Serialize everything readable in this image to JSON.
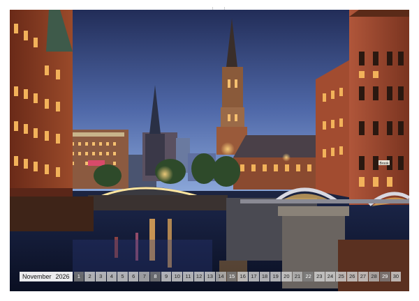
{
  "calendar": {
    "month": "November",
    "year": "2026",
    "days": [
      {
        "num": "1",
        "type": "sunday"
      },
      {
        "num": "2",
        "type": "weekday"
      },
      {
        "num": "3",
        "type": "weekday"
      },
      {
        "num": "4",
        "type": "weekday"
      },
      {
        "num": "5",
        "type": "weekday"
      },
      {
        "num": "6",
        "type": "weekday"
      },
      {
        "num": "7",
        "type": "saturday"
      },
      {
        "num": "8",
        "type": "sunday"
      },
      {
        "num": "9",
        "type": "weekday"
      },
      {
        "num": "10",
        "type": "weekday"
      },
      {
        "num": "11",
        "type": "weekday"
      },
      {
        "num": "12",
        "type": "weekday"
      },
      {
        "num": "13",
        "type": "weekday"
      },
      {
        "num": "14",
        "type": "saturday"
      },
      {
        "num": "15",
        "type": "sunday"
      },
      {
        "num": "16",
        "type": "weekday"
      },
      {
        "num": "17",
        "type": "weekday"
      },
      {
        "num": "18",
        "type": "weekday"
      },
      {
        "num": "19",
        "type": "weekday"
      },
      {
        "num": "20",
        "type": "weekday"
      },
      {
        "num": "21",
        "type": "saturday"
      },
      {
        "num": "22",
        "type": "sunday"
      },
      {
        "num": "23",
        "type": "weekday"
      },
      {
        "num": "24",
        "type": "weekday"
      },
      {
        "num": "25",
        "type": "weekday"
      },
      {
        "num": "26",
        "type": "weekday"
      },
      {
        "num": "27",
        "type": "weekday"
      },
      {
        "num": "28",
        "type": "saturday"
      },
      {
        "num": "29",
        "type": "sunday"
      },
      {
        "num": "30",
        "type": "weekday"
      }
    ]
  },
  "photo": {
    "sign_text": "Brook",
    "colors": {
      "sky_top": "#26335f",
      "sky_bottom": "#6a8cc8",
      "brick": "#8a3a24",
      "window_light": "#f2b25a",
      "water": "#111a33"
    }
  }
}
